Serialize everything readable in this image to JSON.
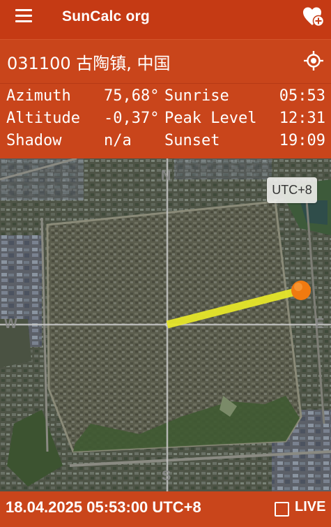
{
  "app": {
    "title": "SunCalc org"
  },
  "location": {
    "text": "031100 古陶镇, 中国"
  },
  "info": {
    "azimuth_label": "Azimuth",
    "azimuth_value": "75,68°",
    "altitude_label": "Altitude",
    "altitude_value": "-0,37°",
    "shadow_label": "Shadow",
    "shadow_value": "n/a",
    "sunrise_label": "Sunrise",
    "sunrise_value": "05:53",
    "peak_label": "Peak Level",
    "peak_value": "12:31",
    "sunset_label": "Sunset",
    "sunset_value": "19:09"
  },
  "map": {
    "timezone_badge": "UTC+8",
    "compass": {
      "north": "N",
      "south": "S",
      "east": "E",
      "west": "W"
    }
  },
  "footer": {
    "datetime": "18.04.2025 05:53:00 UTC+8",
    "live_label": "LIVE",
    "live_checked": false
  },
  "colors": {
    "primary": "#c53a14",
    "bar": "#c9451b",
    "sun": "#f07a10",
    "sun_line": "#e6e62a"
  },
  "icons": {
    "menu": "menu-icon",
    "favorite": "heart-plus-icon",
    "locate": "gps-target-icon"
  }
}
